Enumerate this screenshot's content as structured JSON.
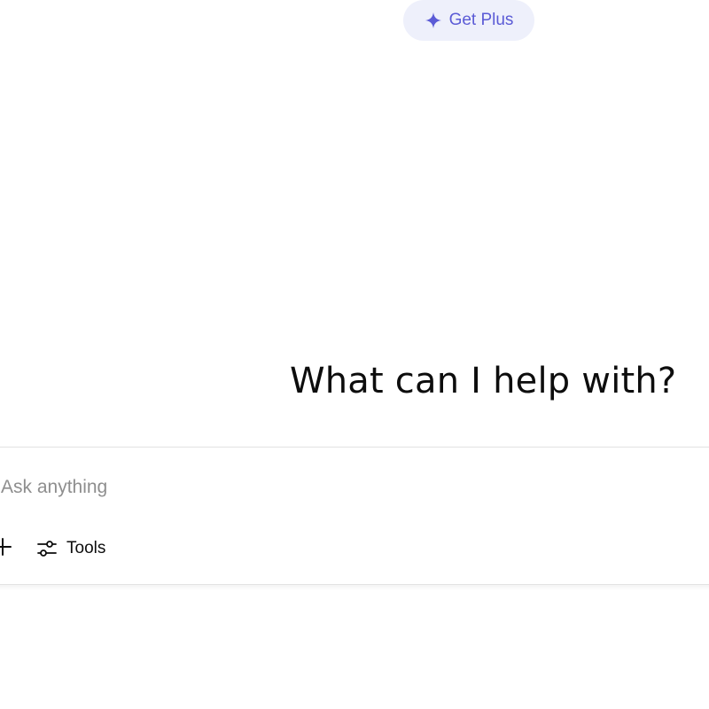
{
  "header": {
    "get_plus_label": "Get Plus",
    "get_plus_icon": "sparkle-icon",
    "accent_color": "#5b5bd6"
  },
  "main": {
    "heading": "What can I help with?"
  },
  "composer": {
    "placeholder": "Ask anything",
    "value": "",
    "add_icon": "plus-icon",
    "tools_label": "Tools",
    "tools_icon": "sliders-icon"
  }
}
